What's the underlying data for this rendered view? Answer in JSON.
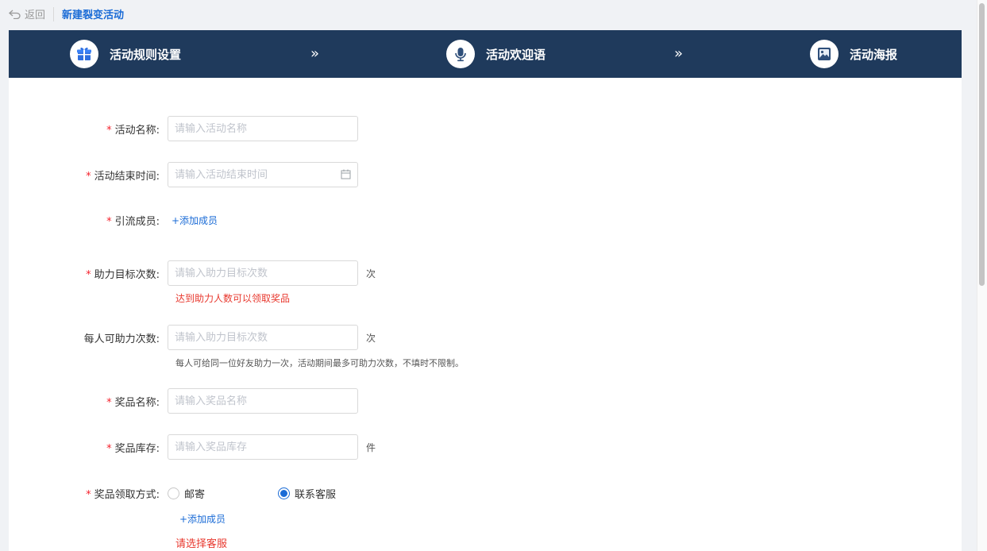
{
  "header": {
    "back_label": "返回",
    "title": "新建裂变活动"
  },
  "steps": [
    {
      "label": "活动规则设置",
      "icon": "gift-icon"
    },
    {
      "label": "活动欢迎语",
      "icon": "microphone-icon"
    },
    {
      "label": "活动海报",
      "icon": "image-icon"
    }
  ],
  "arrows": [
    "»",
    "»"
  ],
  "form": {
    "name": {
      "label": "活动名称:",
      "placeholder": "请输入活动名称"
    },
    "end_time": {
      "label": "活动结束时间:",
      "placeholder": "请输入活动结束时间"
    },
    "members": {
      "label": "引流成员:",
      "add": "+添加成员"
    },
    "target": {
      "label": "助力目标次数:",
      "placeholder": "请输入助力目标次数",
      "unit": "次",
      "error": "达到助力人数可以领取奖品"
    },
    "per_person": {
      "label": "每人可助力次数:",
      "placeholder": "请输入助力目标次数",
      "unit": "次",
      "hint": "每人可给同一位好友助力一次，活动期间最多可助力次数，不填时不限制。"
    },
    "prize_name": {
      "label": "奖品名称:",
      "placeholder": "请输入奖品名称"
    },
    "prize_stock": {
      "label": "奖品库存:",
      "placeholder": "请输入奖品库存",
      "unit": "件"
    },
    "claim": {
      "label": "奖品领取方式:",
      "options": [
        {
          "label": "邮寄",
          "selected": false
        },
        {
          "label": "联系客服",
          "selected": true
        }
      ],
      "add": "+添加成员",
      "error": "请选择客服"
    }
  },
  "required_mark": "*",
  "colors": {
    "accent": "#1a6bd6",
    "step_bar": "#1f3a5c",
    "error": "#e8382e"
  }
}
